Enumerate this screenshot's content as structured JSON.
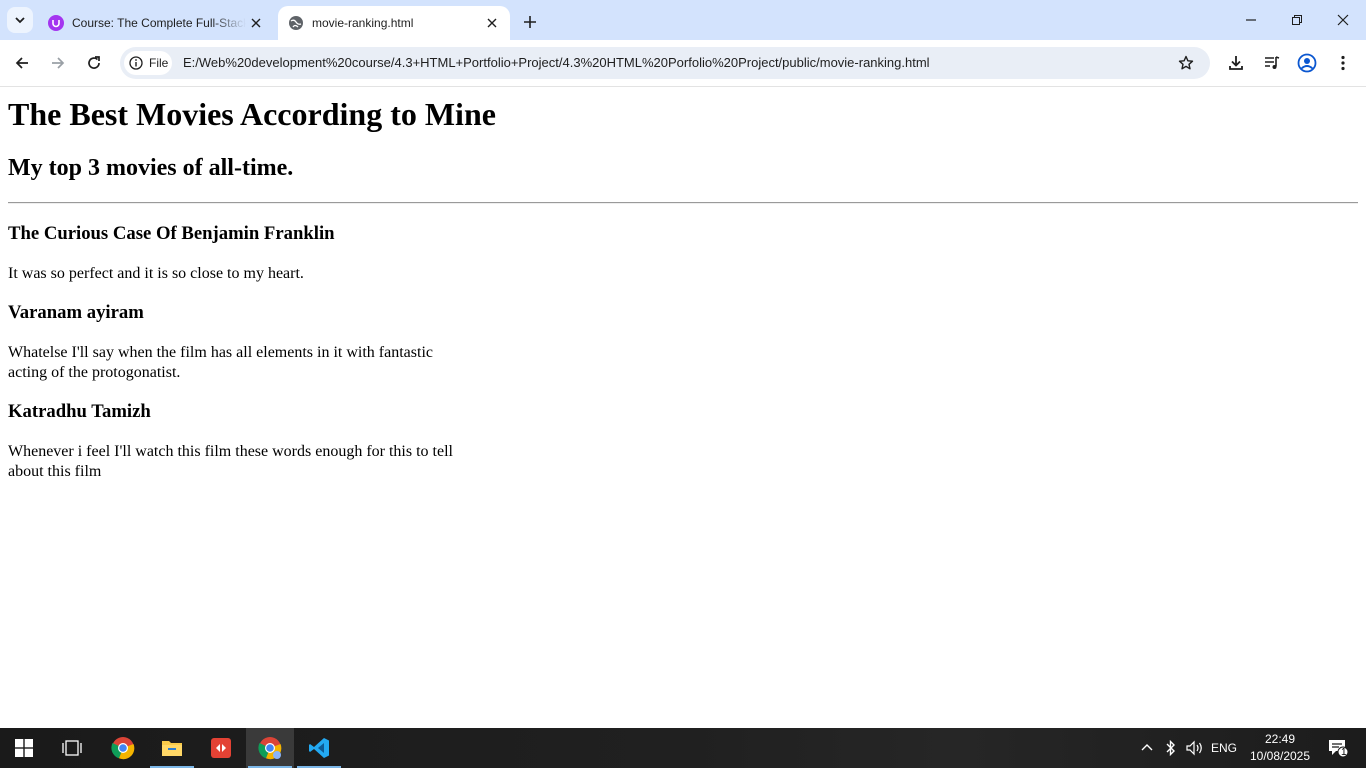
{
  "browser": {
    "tabs": [
      {
        "title": "Course: The Complete Full-Stack Web Development Bootcamp",
        "active": false,
        "favicon": "udemy-icon"
      },
      {
        "title": "movie-ranking.html",
        "active": true,
        "favicon": "globe-icon"
      }
    ],
    "omnibox": {
      "chip_label": "File",
      "url": "E:/Web%20development%20course/4.3+HTML+Portfolio+Project/4.3%20HTML%20Porfolio%20Project/public/movie-ranking.html"
    },
    "accent": "#d3e3fd"
  },
  "page": {
    "heading": "The Best Movies According to Mine",
    "subheading": "My top 3 movies of all-time.",
    "movies": [
      {
        "title": "The Curious Case Of Benjamin Franklin",
        "review": "It was so perfect and it is so close to my heart."
      },
      {
        "title": "Varanam ayiram",
        "review": "Whatelse I'll say when the film has all elements in it with fantastic acting of the protogonatist."
      },
      {
        "title": "Katradhu Tamizh",
        "review": "Whenever i feel I'll watch this film these words enough for this to tell about this film"
      }
    ]
  },
  "taskbar": {
    "language": "ENG",
    "time": "22:49",
    "date": "10/08/2025",
    "notification_count": "1"
  }
}
